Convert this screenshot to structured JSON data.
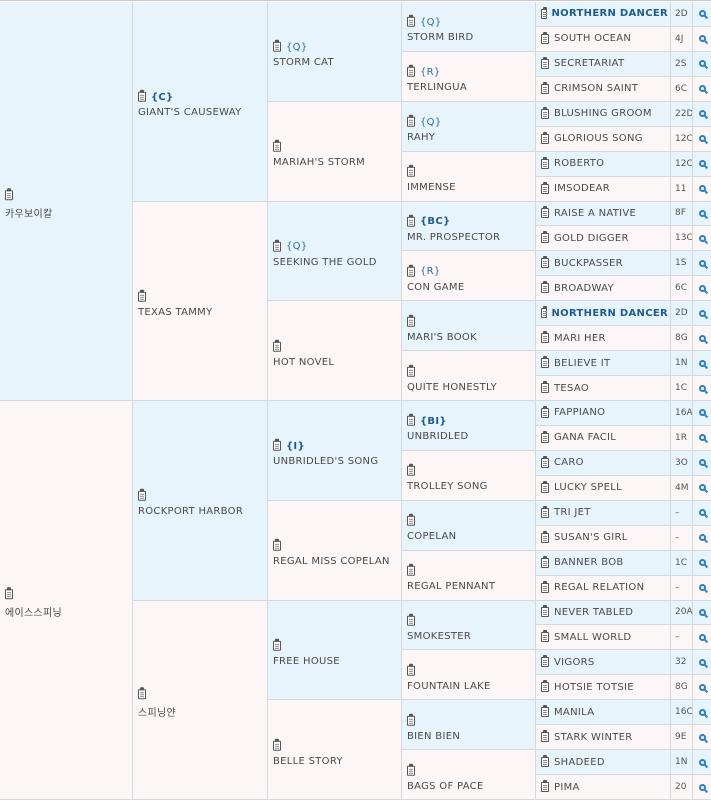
{
  "pedigree": {
    "gen1": [
      {
        "name": "카우보이칼",
        "badge": "",
        "bold": false
      },
      {
        "name": "에이스스피닝",
        "badge": "",
        "bold": false
      }
    ],
    "gen2": [
      {
        "name": "GIANT'S CAUSEWAY",
        "badge": "{C}",
        "bold": true
      },
      {
        "name": "TEXAS TAMMY",
        "badge": "",
        "bold": false
      },
      {
        "name": "ROCKPORT HARBOR",
        "badge": "",
        "bold": false
      },
      {
        "name": "스피닝얀",
        "badge": "",
        "bold": false
      }
    ],
    "gen3": [
      {
        "name": "STORM CAT",
        "badge": "{Q}",
        "bold": false
      },
      {
        "name": "MARIAH'S STORM",
        "badge": "",
        "bold": false
      },
      {
        "name": "SEEKING THE GOLD",
        "badge": "{Q}",
        "bold": false
      },
      {
        "name": "HOT NOVEL",
        "badge": "",
        "bold": false
      },
      {
        "name": "UNBRIDLED'S SONG",
        "badge": "{I}",
        "bold": true
      },
      {
        "name": "REGAL MISS COPELAN",
        "badge": "",
        "bold": false
      },
      {
        "name": "FREE HOUSE",
        "badge": "",
        "bold": false
      },
      {
        "name": "BELLE STORY",
        "badge": "",
        "bold": false
      }
    ],
    "gen4": [
      {
        "name": "STORM BIRD",
        "badge": "{Q}",
        "bold": false
      },
      {
        "name": "TERLINGUA",
        "badge": "{R}",
        "bold": false
      },
      {
        "name": "RAHY",
        "badge": "{Q}",
        "bold": false
      },
      {
        "name": "IMMENSE",
        "badge": "",
        "bold": false
      },
      {
        "name": "MR. PROSPECTOR",
        "badge": "{BC}",
        "bold": true
      },
      {
        "name": "CON GAME",
        "badge": "{R}",
        "bold": false
      },
      {
        "name": "MARI'S BOOK",
        "badge": "",
        "bold": false
      },
      {
        "name": "QUITE HONESTLY",
        "badge": "",
        "bold": false
      },
      {
        "name": "UNBRIDLED",
        "badge": "{BI}",
        "bold": true
      },
      {
        "name": "TROLLEY SONG",
        "badge": "",
        "bold": false
      },
      {
        "name": "COPELAN",
        "badge": "",
        "bold": false
      },
      {
        "name": "REGAL PENNANT",
        "badge": "",
        "bold": false
      },
      {
        "name": "SMOKESTER",
        "badge": "",
        "bold": false
      },
      {
        "name": "FOUNTAIN LAKE",
        "badge": "",
        "bold": false
      },
      {
        "name": "BIEN BIEN",
        "badge": "",
        "bold": false
      },
      {
        "name": "BAGS OF PACE",
        "badge": "",
        "bold": false
      }
    ],
    "gen5": [
      {
        "name": "NORTHERN DANCER",
        "code": "2D",
        "highlight": true
      },
      {
        "name": "SOUTH OCEAN",
        "code": "4J",
        "highlight": false
      },
      {
        "name": "SECRETARIAT",
        "code": "2S",
        "highlight": false
      },
      {
        "name": "CRIMSON SAINT",
        "code": "6C",
        "highlight": false
      },
      {
        "name": "BLUSHING GROOM",
        "code": "22D",
        "highlight": false
      },
      {
        "name": "GLORIOUS SONG",
        "code": "12C",
        "highlight": false
      },
      {
        "name": "ROBERTO",
        "code": "12C",
        "highlight": false
      },
      {
        "name": "IMSODEAR",
        "code": "11",
        "highlight": false
      },
      {
        "name": "RAISE A NATIVE",
        "code": "8F",
        "highlight": false
      },
      {
        "name": "GOLD DIGGER",
        "code": "13C",
        "highlight": false
      },
      {
        "name": "BUCKPASSER",
        "code": "1S",
        "highlight": false
      },
      {
        "name": "BROADWAY",
        "code": "6C",
        "highlight": false
      },
      {
        "name": "NORTHERN DANCER",
        "code": "2D",
        "highlight": true
      },
      {
        "name": "MARI HER",
        "code": "8G",
        "highlight": false
      },
      {
        "name": "BELIEVE IT",
        "code": "1N",
        "highlight": false
      },
      {
        "name": "TESAO",
        "code": "1C",
        "highlight": false
      },
      {
        "name": "FAPPIANO",
        "code": "16A",
        "highlight": false
      },
      {
        "name": "GANA FACIL",
        "code": "1R",
        "highlight": false
      },
      {
        "name": "CARO",
        "code": "3O",
        "highlight": false
      },
      {
        "name": "LUCKY SPELL",
        "code": "4M",
        "highlight": false
      },
      {
        "name": "TRI JET",
        "code": "–",
        "highlight": false
      },
      {
        "name": "SUSAN'S GIRL",
        "code": "–",
        "highlight": false
      },
      {
        "name": "BANNER BOB",
        "code": "1C",
        "highlight": false
      },
      {
        "name": "REGAL RELATION",
        "code": "–",
        "highlight": false
      },
      {
        "name": "NEVER TABLED",
        "code": "20A",
        "highlight": false
      },
      {
        "name": "SMALL WORLD",
        "code": "–",
        "highlight": false
      },
      {
        "name": "VIGORS",
        "code": "32",
        "highlight": false
      },
      {
        "name": "HOTSIE TOTSIE",
        "code": "8G",
        "highlight": false
      },
      {
        "name": "MANILA",
        "code": "16C",
        "highlight": false
      },
      {
        "name": "STARK WINTER",
        "code": "9E",
        "highlight": false
      },
      {
        "name": "SHADEED",
        "code": "1N",
        "highlight": false
      },
      {
        "name": "PIMA",
        "code": "20",
        "highlight": false
      }
    ]
  },
  "icons": {
    "note": "clipboard-icon",
    "search": "magnifier-icon"
  },
  "colors": {
    "sire_bg": "#e7f4fb",
    "dam_bg": "#fdf6f6",
    "highlight_text": "#1f5b8f",
    "badge_text": "#2f6f9e",
    "magnifier": "#2b7fc4"
  }
}
